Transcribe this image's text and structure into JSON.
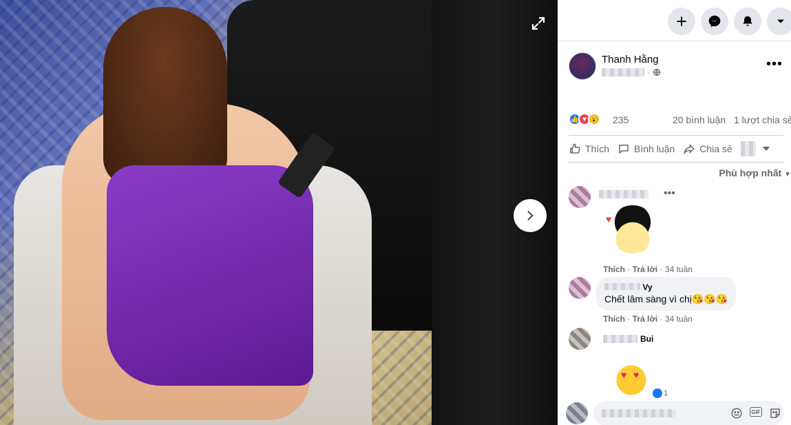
{
  "post": {
    "author": "Thanh Hằng",
    "reaction_count": "235",
    "comments": "20 bình luận",
    "shares": "1 lượt chia sẻ"
  },
  "actions": {
    "like": "Thích",
    "comment": "Bình luận",
    "share": "Chia sẻ"
  },
  "sort_label": "Phù hợp nhất",
  "comments": [
    {
      "author_visible": "",
      "text": "",
      "like": "Thích",
      "reply": "Trả lời",
      "time": "34 tuần"
    },
    {
      "author_visible": "Vy",
      "text": "Chết lâm sàng vì chị😘😘😘",
      "like": "Thích",
      "reply": "Trả lời",
      "time": "34 tuần"
    },
    {
      "author_visible": "Bui",
      "text": "",
      "sticker_reaction_count": "1"
    }
  ],
  "icons": {
    "fullscreen": "expand-icon",
    "next": "chevron-right-icon",
    "create": "plus-icon",
    "messenger": "messenger-icon",
    "notifications": "bell-icon",
    "account": "caret-down-icon",
    "more": "more-horizontal-icon",
    "privacy": "globe-icon"
  },
  "colors": {
    "like_blue": "#1877f2",
    "love_red": "#f33e58",
    "wow_yellow": "#f7b125",
    "text_secondary": "#65676b"
  }
}
